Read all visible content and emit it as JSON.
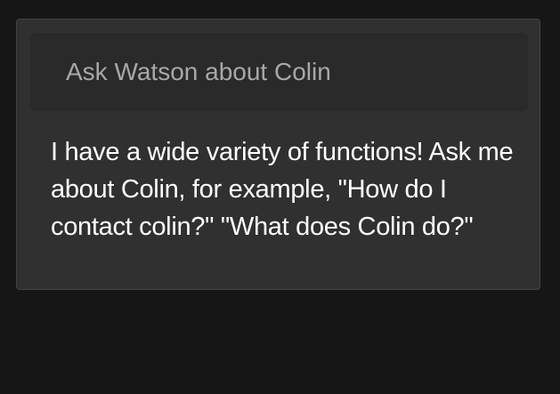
{
  "ask_box": {
    "placeholder": "Ask Watson about Colin",
    "value": ""
  },
  "response": {
    "text": "I have a wide variety of functions! Ask me about Colin, for example, \"How do I contact colin?\" \"What does Colin do?\""
  },
  "colors": {
    "page_background": "#161616",
    "panel_background": "#303030",
    "input_background": "#2a2a2a",
    "placeholder_text": "#a8a8a8",
    "response_text": "#ffffff"
  }
}
